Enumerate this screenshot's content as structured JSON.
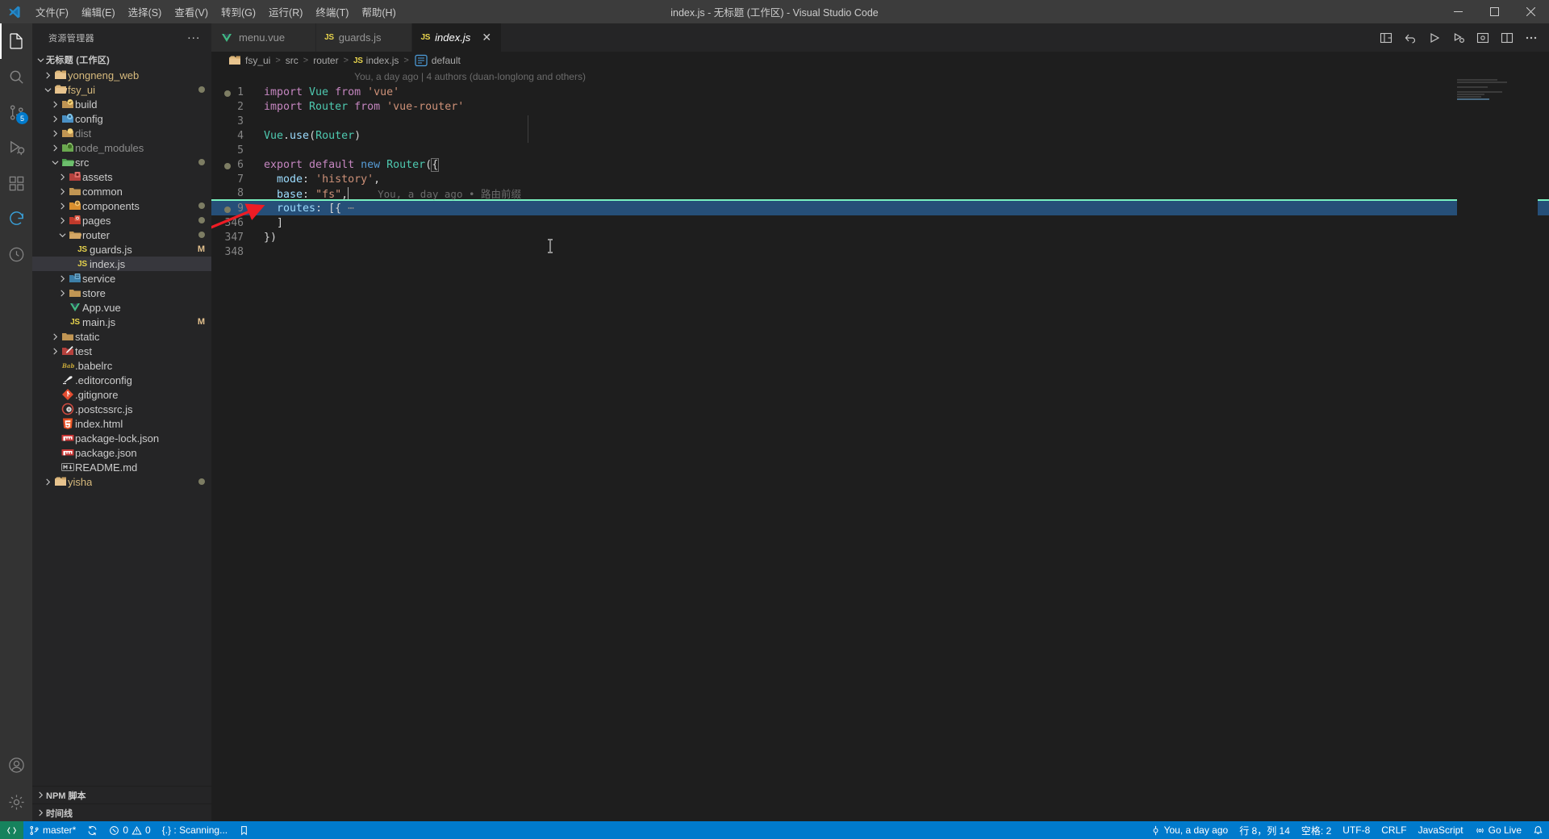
{
  "window": {
    "title": "index.js - 无标题 (工作区) - Visual Studio Code",
    "minimize": "–",
    "maximize": "□",
    "close": "✕"
  },
  "menubar": {
    "items": [
      {
        "label": "文件(F)",
        "name": "menu-file"
      },
      {
        "label": "编辑(E)",
        "name": "menu-edit"
      },
      {
        "label": "选择(S)",
        "name": "menu-selection"
      },
      {
        "label": "查看(V)",
        "name": "menu-view"
      },
      {
        "label": "转到(G)",
        "name": "menu-go"
      },
      {
        "label": "运行(R)",
        "name": "menu-run"
      },
      {
        "label": "终端(T)",
        "name": "menu-terminal"
      },
      {
        "label": "帮助(H)",
        "name": "menu-help"
      }
    ]
  },
  "activitybar": {
    "items": [
      {
        "name": "explorer-icon",
        "title": "资源管理器",
        "active": true,
        "badge": ""
      },
      {
        "name": "search-icon",
        "title": "搜索",
        "active": false,
        "badge": ""
      },
      {
        "name": "source-control-icon",
        "title": "源代码管理",
        "active": false,
        "badge": "5"
      },
      {
        "name": "run-debug-icon",
        "title": "运行和调试",
        "active": false,
        "badge": ""
      },
      {
        "name": "extensions-icon",
        "title": "扩展",
        "active": false,
        "badge": ""
      },
      {
        "name": "refresh-sync-icon",
        "title": "同步",
        "active": false,
        "badge": ""
      },
      {
        "name": "circle-clock-icon",
        "title": "时间线",
        "active": false,
        "badge": ""
      }
    ],
    "bottom": [
      {
        "name": "account-icon",
        "title": "账户"
      },
      {
        "name": "settings-gear-icon",
        "title": "管理"
      }
    ]
  },
  "sidebar": {
    "header": "资源管理器",
    "more_actions": "···",
    "tree": [
      {
        "label": "无标题 (工作区)",
        "indent": 0,
        "twisty": "down",
        "icon": "none",
        "kind": "workspace"
      },
      {
        "label": "yongneng_web",
        "indent": 1,
        "twisty": "right",
        "icon": "folder-root",
        "kind": "folder"
      },
      {
        "label": "fsy_ui",
        "indent": 1,
        "twisty": "down",
        "icon": "folder-root-open",
        "kind": "folder",
        "badge": "dot"
      },
      {
        "label": "build",
        "indent": 2,
        "twisty": "right",
        "icon": "folder-build",
        "kind": "folder"
      },
      {
        "label": "config",
        "indent": 2,
        "twisty": "right",
        "icon": "folder-config",
        "kind": "folder"
      },
      {
        "label": "dist",
        "indent": 2,
        "twisty": "right",
        "icon": "folder-dist",
        "kind": "folder",
        "dim": true
      },
      {
        "label": "node_modules",
        "indent": 2,
        "twisty": "right",
        "icon": "folder-node",
        "kind": "folder",
        "dim": true
      },
      {
        "label": "src",
        "indent": 2,
        "twisty": "down",
        "icon": "folder-src-open",
        "kind": "folder",
        "badge": "dot"
      },
      {
        "label": "assets",
        "indent": 3,
        "twisty": "right",
        "icon": "folder-assets",
        "kind": "folder"
      },
      {
        "label": "common",
        "indent": 3,
        "twisty": "right",
        "icon": "folder-plain",
        "kind": "folder"
      },
      {
        "label": "components",
        "indent": 3,
        "twisty": "right",
        "icon": "folder-components",
        "kind": "folder",
        "badge": "dot"
      },
      {
        "label": "pages",
        "indent": 3,
        "twisty": "right",
        "icon": "folder-pages",
        "kind": "folder",
        "badge": "dot"
      },
      {
        "label": "router",
        "indent": 3,
        "twisty": "down",
        "icon": "folder-plain-open",
        "kind": "folder",
        "badge": "dot"
      },
      {
        "label": "guards.js",
        "indent": 4,
        "twisty": "none",
        "icon": "js",
        "kind": "file",
        "git": "M"
      },
      {
        "label": "index.js",
        "indent": 4,
        "twisty": "none",
        "icon": "js",
        "kind": "file",
        "selected": true
      },
      {
        "label": "service",
        "indent": 3,
        "twisty": "right",
        "icon": "folder-service",
        "kind": "folder"
      },
      {
        "label": "store",
        "indent": 3,
        "twisty": "right",
        "icon": "folder-plain",
        "kind": "folder"
      },
      {
        "label": "App.vue",
        "indent": 3,
        "twisty": "none",
        "icon": "vue",
        "kind": "file"
      },
      {
        "label": "main.js",
        "indent": 3,
        "twisty": "none",
        "icon": "js",
        "kind": "file",
        "git": "M"
      },
      {
        "label": "static",
        "indent": 2,
        "twisty": "right",
        "icon": "folder-plain",
        "kind": "folder"
      },
      {
        "label": "test",
        "indent": 2,
        "twisty": "right",
        "icon": "folder-test",
        "kind": "folder"
      },
      {
        "label": ".babelrc",
        "indent": 2,
        "twisty": "none",
        "icon": "babel",
        "kind": "file"
      },
      {
        "label": ".editorconfig",
        "indent": 2,
        "twisty": "none",
        "icon": "editorconfig",
        "kind": "file"
      },
      {
        "label": ".gitignore",
        "indent": 2,
        "twisty": "none",
        "icon": "git",
        "kind": "file"
      },
      {
        "label": ".postcssrc.js",
        "indent": 2,
        "twisty": "none",
        "icon": "postcss",
        "kind": "file"
      },
      {
        "label": "index.html",
        "indent": 2,
        "twisty": "none",
        "icon": "html",
        "kind": "file"
      },
      {
        "label": "package-lock.json",
        "indent": 2,
        "twisty": "none",
        "icon": "npm",
        "kind": "file"
      },
      {
        "label": "package.json",
        "indent": 2,
        "twisty": "none",
        "icon": "npm",
        "kind": "file"
      },
      {
        "label": "README.md",
        "indent": 2,
        "twisty": "none",
        "icon": "markdown",
        "kind": "file"
      },
      {
        "label": "yisha",
        "indent": 1,
        "twisty": "right",
        "icon": "folder-root",
        "kind": "folder",
        "badge": "dot"
      }
    ],
    "sections": [
      {
        "label": "NPM 脚本",
        "name": "section-npm-scripts"
      },
      {
        "label": "时间线",
        "name": "section-timeline"
      }
    ]
  },
  "tabs": [
    {
      "label": "menu.vue",
      "icon": "vue",
      "active": false,
      "name": "tab-menu-vue"
    },
    {
      "label": "guards.js",
      "icon": "js",
      "active": false,
      "name": "tab-guards-js"
    },
    {
      "label": "index.js",
      "icon": "js",
      "active": true,
      "name": "tab-index-js"
    }
  ],
  "editor_actions": [
    {
      "name": "split-editor-layout-icon"
    },
    {
      "name": "go-back-icon"
    },
    {
      "name": "run-icon"
    },
    {
      "name": "run-debug-icon"
    },
    {
      "name": "toggle-panel-icon"
    },
    {
      "name": "split-editor-right-icon"
    },
    {
      "name": "more-actions-icon"
    }
  ],
  "breadcrumbs": [
    {
      "label": "fsy_ui",
      "icon": "folder-root"
    },
    {
      "label": "src",
      "icon": "none"
    },
    {
      "label": "router",
      "icon": "none"
    },
    {
      "label": "index.js",
      "icon": "js"
    },
    {
      "label": "default",
      "icon": "symbol-object"
    }
  ],
  "editor": {
    "blame_header": "You, a day ago | 4 authors (duan-longlong and others)",
    "inline_blame": "You, a day ago • 路由前缀",
    "lines": [
      {
        "num": "1",
        "breakpoint": true,
        "tokens": [
          {
            "t": "import ",
            "c": "kw"
          },
          {
            "t": "Vue",
            "c": "type"
          },
          {
            "t": " from ",
            "c": "kw"
          },
          {
            "t": "'vue'",
            "c": "str"
          }
        ]
      },
      {
        "num": "2",
        "breakpoint": false,
        "tokens": [
          {
            "t": "import ",
            "c": "kw"
          },
          {
            "t": "Router",
            "c": "type"
          },
          {
            "t": " from ",
            "c": "kw"
          },
          {
            "t": "'vue-router'",
            "c": "str"
          }
        ]
      },
      {
        "num": "3",
        "breakpoint": false,
        "tokens": []
      },
      {
        "num": "4",
        "breakpoint": false,
        "tokens": [
          {
            "t": "Vue",
            "c": "type"
          },
          {
            "t": ".",
            "c": "plain"
          },
          {
            "t": "use",
            "c": "id2"
          },
          {
            "t": "(",
            "c": "plain"
          },
          {
            "t": "Router",
            "c": "type"
          },
          {
            "t": ")",
            "c": "plain"
          }
        ]
      },
      {
        "num": "5",
        "breakpoint": false,
        "tokens": []
      },
      {
        "num": "6",
        "breakpoint": true,
        "tokens": [
          {
            "t": "export ",
            "c": "kw"
          },
          {
            "t": "default ",
            "c": "kw"
          },
          {
            "t": "new ",
            "c": "kw2"
          },
          {
            "t": "Router",
            "c": "type"
          },
          {
            "t": "(",
            "c": "plain"
          },
          {
            "t": "{",
            "c": "bracket"
          }
        ]
      },
      {
        "num": "7",
        "breakpoint": false,
        "tokens": [
          {
            "t": "  ",
            "c": "plain"
          },
          {
            "t": "mode",
            "c": "prop"
          },
          {
            "t": ": ",
            "c": "plain"
          },
          {
            "t": "'history'",
            "c": "str"
          },
          {
            "t": ",",
            "c": "plain"
          }
        ]
      },
      {
        "num": "8",
        "breakpoint": false,
        "cursorline": true,
        "tokens": [
          {
            "t": "  ",
            "c": "plain"
          },
          {
            "t": "base",
            "c": "prop"
          },
          {
            "t": ": ",
            "c": "plain"
          },
          {
            "t": "\"fs\"",
            "c": "str"
          },
          {
            "t": ",",
            "c": "plain"
          }
        ]
      },
      {
        "num": "9",
        "breakpoint": true,
        "selected": true,
        "fold": true,
        "tokens": [
          {
            "t": "  ",
            "c": "plain"
          },
          {
            "t": "routes",
            "c": "prop"
          },
          {
            "t": ": ",
            "c": "plain"
          },
          {
            "t": "[{",
            "c": "plain"
          },
          {
            "t": " ⋯",
            "c": "dots"
          }
        ]
      },
      {
        "num": "346",
        "breakpoint": false,
        "tokens": [
          {
            "t": "  ",
            "c": "plain"
          },
          {
            "t": "]",
            "c": "plain"
          }
        ]
      },
      {
        "num": "347",
        "breakpoint": false,
        "tokens": [
          {
            "t": "}",
            "c": "plain"
          },
          {
            "t": ")",
            "c": "plain"
          }
        ]
      },
      {
        "num": "348",
        "breakpoint": false,
        "tokens": []
      }
    ]
  },
  "statusbar": {
    "left": [
      {
        "name": "remote-indicator",
        "icon": "remote-icon",
        "label": ""
      },
      {
        "name": "git-branch",
        "icon": "branch-icon",
        "label": "master*"
      },
      {
        "name": "git-sync",
        "icon": "sync-icon",
        "label": ""
      },
      {
        "name": "problems",
        "icon": "error-warning-icon",
        "label": "0  0"
      },
      {
        "name": "scanning-status",
        "icon": "",
        "label": "{.} : Scanning..."
      },
      {
        "name": "bookmark-icon",
        "icon": "bookmark-icon",
        "label": ""
      }
    ],
    "problems": {
      "errors": "0",
      "warnings": "0"
    },
    "right": [
      {
        "name": "git-blame-status",
        "icon": "git-commit-icon",
        "label": "You, a day ago"
      },
      {
        "name": "cursor-position",
        "label": "行 8，列 14"
      },
      {
        "name": "indentation",
        "label": "空格: 2"
      },
      {
        "name": "encoding",
        "label": "UTF-8"
      },
      {
        "name": "eol",
        "label": "CRLF"
      },
      {
        "name": "language-mode",
        "label": "JavaScript"
      },
      {
        "name": "go-live",
        "icon": "broadcast-icon",
        "label": "Go Live"
      },
      {
        "name": "notifications",
        "icon": "bell-icon",
        "label": ""
      }
    ]
  },
  "colors": {
    "accent": "#007acc",
    "titlebar": "#3c3c3c",
    "sidebar": "#252526",
    "editor": "#1e1e1e",
    "activitybar": "#333333",
    "selection": "#264f78",
    "arrow": "#ee1c25"
  }
}
